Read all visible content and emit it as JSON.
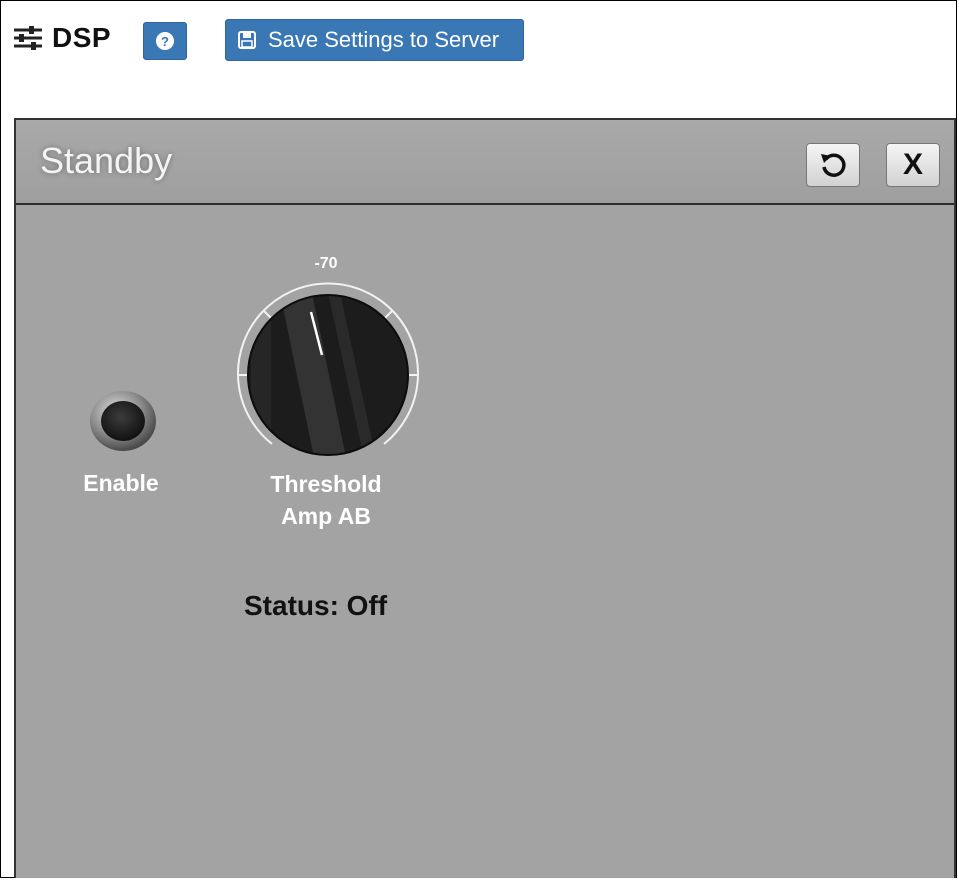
{
  "header": {
    "title": "DSP",
    "help_label": "?",
    "save_label": "Save Settings to Server",
    "icons": {
      "settings": "sliders-icon",
      "help": "question-circle-icon",
      "save": "floppy-disk-icon"
    },
    "accent_color": "#3a77b5"
  },
  "panel": {
    "title": "Standby",
    "reset_icon": "reset-icon",
    "close_label": "X",
    "enable": {
      "label": "Enable",
      "state": "off"
    },
    "threshold": {
      "value_text": "-70",
      "label_line1": "Threshold",
      "label_line2": "Amp AB"
    },
    "status_text": "Status: Off",
    "background_color": "#a3a3a3"
  }
}
